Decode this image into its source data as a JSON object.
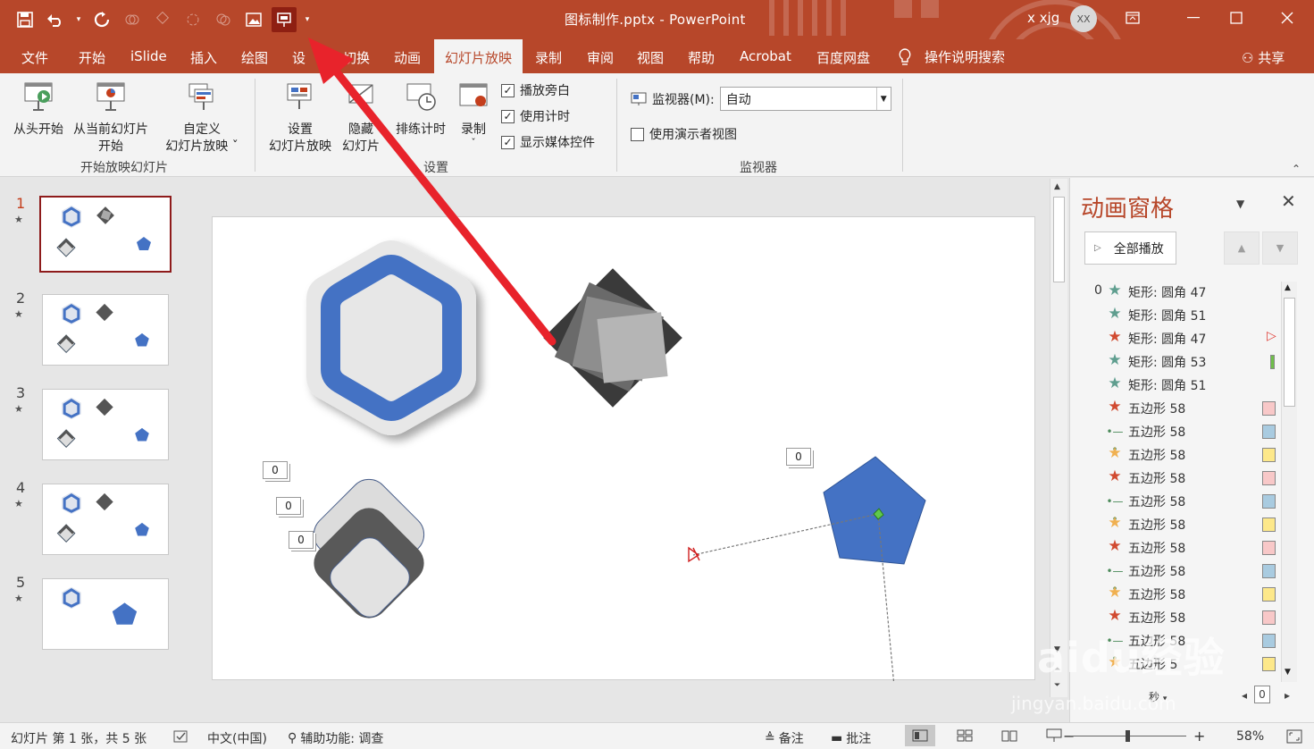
{
  "window": {
    "title": "图标制作.pptx - PowerPoint",
    "user": "x xjg",
    "avatar_initials": "XX",
    "accent": "#b7472a"
  },
  "tabs": [
    {
      "label": "文件",
      "active": false
    },
    {
      "label": "开始",
      "active": false
    },
    {
      "label": "iSlide",
      "active": false
    },
    {
      "label": "插入",
      "active": false
    },
    {
      "label": "绘图",
      "active": false
    },
    {
      "label": "设",
      "active": false
    },
    {
      "label": "切换",
      "active": false
    },
    {
      "label": "动画",
      "active": false
    },
    {
      "label": "幻灯片放映",
      "active": true
    },
    {
      "label": "录制",
      "active": false
    },
    {
      "label": "审阅",
      "active": false
    },
    {
      "label": "视图",
      "active": false
    },
    {
      "label": "帮助",
      "active": false
    },
    {
      "label": "Acrobat",
      "active": false
    },
    {
      "label": "百度网盘",
      "active": false
    }
  ],
  "tell_me": "操作说明搜索",
  "share": "共享",
  "ribbon": {
    "start_group": {
      "from_beginning": "从头开始",
      "from_current_1": "从当前幻灯片",
      "from_current_2": "开始",
      "custom_1": "自定义",
      "custom_2": "幻灯片放映 ˇ",
      "label": "开始放映幻灯片"
    },
    "setup_group": {
      "setup_1": "设置",
      "setup_2": "幻灯片放映",
      "hide_1": "隐藏",
      "hide_2": "幻灯片",
      "rehearse": "排练计时",
      "record": "录制",
      "record_arrow": "ˇ",
      "play_narrations": "播放旁白",
      "use_timings": "使用计时",
      "show_media_controls": "显示媒体控件",
      "label": "设置"
    },
    "monitor_group": {
      "monitor_label": "监视器(M):",
      "monitor_value": "自动",
      "presenter_view": "使用演示者视图",
      "label": "监视器"
    }
  },
  "slides": [
    {
      "num": "1",
      "selected": true
    },
    {
      "num": "2",
      "selected": false
    },
    {
      "num": "3",
      "selected": false
    },
    {
      "num": "4",
      "selected": false
    },
    {
      "num": "5",
      "selected": false
    }
  ],
  "slide_tags": [
    "0",
    "0",
    "0",
    "0"
  ],
  "anim_pane": {
    "title": "动画窗格",
    "play_all": "全部播放",
    "first_index": "0",
    "items": [
      {
        "label": "矩形: 圆角 47",
        "icon": "star",
        "color": "#5f9e8f",
        "bar": ""
      },
      {
        "label": "矩形: 圆角 51",
        "icon": "star",
        "color": "#5f9e8f",
        "bar": ""
      },
      {
        "label": "矩形: 圆角 47",
        "icon": "star",
        "color": "#d14a30",
        "bar": "exit-marker"
      },
      {
        "label": "矩形: 圆角 53",
        "icon": "star",
        "color": "#5f9e8f",
        "bar": "#6fbf4a"
      },
      {
        "label": "矩形: 圆角 51",
        "icon": "star",
        "color": "#5f9e8f",
        "bar": ""
      },
      {
        "label": "五边形 58",
        "icon": "star",
        "color": "#d14a30",
        "bar": "#f8c8c8"
      },
      {
        "label": "五边形 58",
        "icon": "line",
        "color": "#4c8b5a",
        "bar": "#a9cbe0"
      },
      {
        "label": "五边形 58",
        "icon": "star",
        "color": "#f0b050",
        "bar": "#fde88a"
      },
      {
        "label": "五边形 58",
        "icon": "star",
        "color": "#d14a30",
        "bar": "#f8c8c8"
      },
      {
        "label": "五边形 58",
        "icon": "line",
        "color": "#4c8b5a",
        "bar": "#a9cbe0"
      },
      {
        "label": "五边形 58",
        "icon": "star",
        "color": "#f0b050",
        "bar": "#fde88a"
      },
      {
        "label": "五边形 58",
        "icon": "star",
        "color": "#d14a30",
        "bar": "#f8c8c8"
      },
      {
        "label": "五边形 58",
        "icon": "line",
        "color": "#4c8b5a",
        "bar": "#a9cbe0"
      },
      {
        "label": "五边形 58",
        "icon": "star",
        "color": "#f0b050",
        "bar": "#fde88a"
      },
      {
        "label": "五边形 58",
        "icon": "star",
        "color": "#d14a30",
        "bar": "#f8c8c8"
      },
      {
        "label": "五边形 58",
        "icon": "line",
        "color": "#4c8b5a",
        "bar": "#a9cbe0"
      },
      {
        "label": "五边形 5",
        "icon": "star",
        "color": "#f0b050",
        "bar": "#fde88a"
      }
    ],
    "footer_seconds": "秒",
    "footer_zoom": "0"
  },
  "status": {
    "slide_info": "幻灯片 第 1 张，共 5 张",
    "language": "中文(中国)",
    "accessibility": "辅助功能: 调查",
    "notes": "备注",
    "comments": "批注",
    "zoom": "58%"
  },
  "watermark": {
    "main": "Baidu经验",
    "url": "jingyan.baidu.com"
  }
}
